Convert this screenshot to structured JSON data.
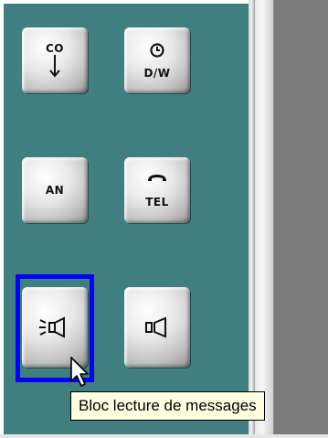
{
  "buttons": {
    "co": {
      "label": "CO",
      "icon": "down-arrow-icon"
    },
    "dw": {
      "label": "D/W",
      "icon": "clock-icon"
    },
    "an": {
      "label": "AN"
    },
    "tel": {
      "label": "TEL",
      "icon": "phone-handset-icon"
    },
    "playback": {
      "icon": "speaker-sound-icon",
      "focused": true
    },
    "speaker": {
      "icon": "speaker-icon"
    }
  },
  "tooltip": {
    "text": "Bloc lecture de messages"
  },
  "colors": {
    "panel": "#3f7f7f",
    "focus": "#0000ff",
    "tooltip_bg": "#ffffe1",
    "gray_area": "#7b7b7b"
  }
}
